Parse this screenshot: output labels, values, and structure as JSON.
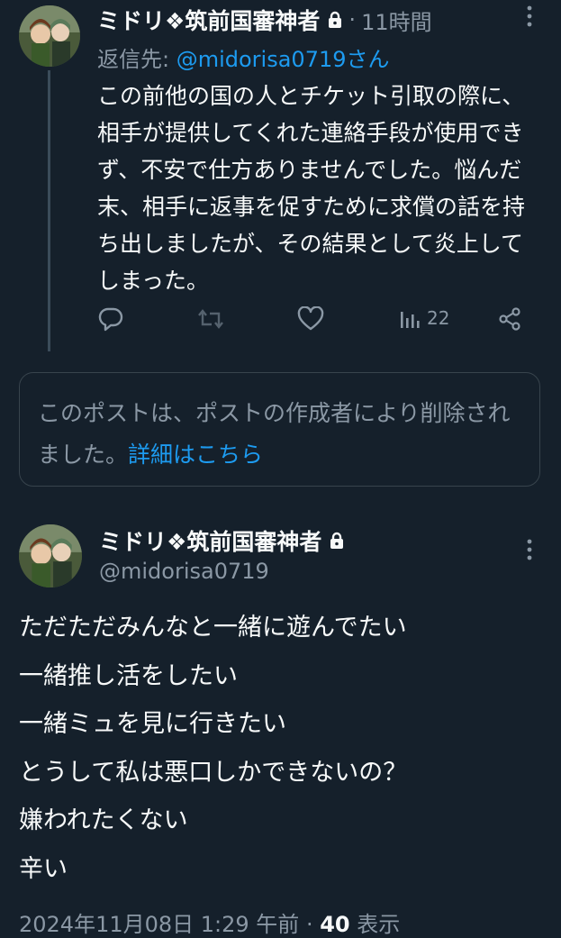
{
  "reply_tweet": {
    "author_name": "ミドリ❖筑前国審神者",
    "time_separator": "·",
    "time": "11時間",
    "reply_prefix": "返信先: ",
    "reply_handle": "@midorisa0719",
    "reply_suffix": "さん",
    "text": "この前他の国の人とチケット引取の際に、相手が提供してくれた連絡手段が使用できず、不安で仕方ありませんでした。悩んだ末、相手に返事を促すために求償の話を持ち出しましたが、その結果として炎上してしまった。",
    "actions": {
      "reply": "reply-icon",
      "repost": "repost-icon",
      "like": "like-icon",
      "views_icon": "views-icon",
      "views_count": "22",
      "share": "share-icon"
    }
  },
  "deleted_notice": {
    "text": "このポストは、ポストの作成者により削除されました。",
    "link": "詳細はこちら"
  },
  "main_tweet": {
    "author_name": "ミドリ❖筑前国審神者",
    "handle": "@midorisa0719",
    "lines": [
      "ただただみんなと一緒に遊んでたい",
      "一緒推し活をしたい",
      "一緒ミュを見に行きたい",
      "とうして私は悪口しかできないの？",
      "嫌われたくない",
      "辛い"
    ],
    "footer_date": "2024年11月08日 1:29 午前",
    "footer_sep": " · ",
    "footer_views": "40",
    "footer_views_label": " 表示"
  },
  "colors": {
    "background": "#15202b",
    "text": "#f7f9f9",
    "secondary": "#8b98a5",
    "link": "#1d9bf0",
    "border": "#38444d"
  }
}
